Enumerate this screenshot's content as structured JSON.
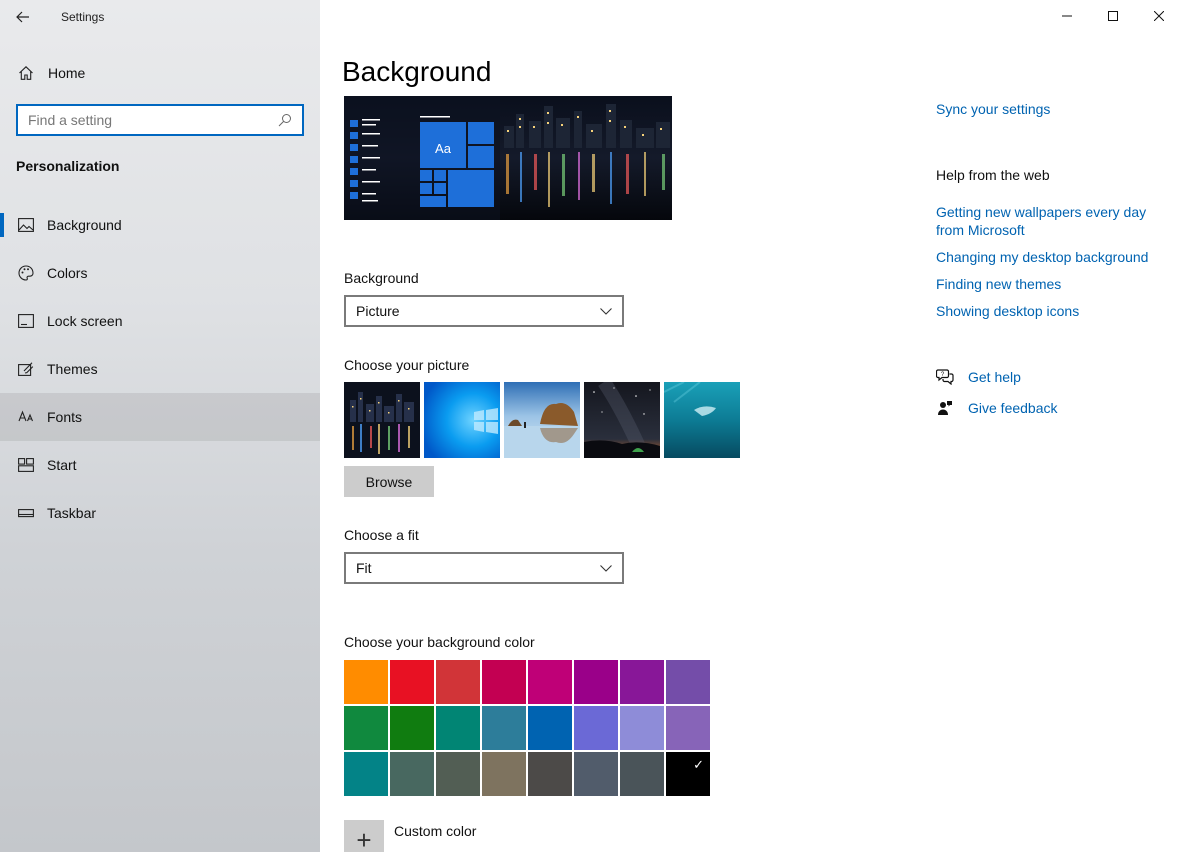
{
  "window": {
    "title": "Settings",
    "controls": [
      "minimize-icon",
      "maximize-icon",
      "close-icon"
    ]
  },
  "sidebar": {
    "home_label": "Home",
    "search_placeholder": "Find a setting",
    "section": "Personalization",
    "items": [
      {
        "label": "Background",
        "icon": "picture-icon",
        "selected": true
      },
      {
        "label": "Colors",
        "icon": "palette-icon"
      },
      {
        "label": "Lock screen",
        "icon": "lock-screen-icon"
      },
      {
        "label": "Themes",
        "icon": "themes-icon"
      },
      {
        "label": "Fonts",
        "icon": "fonts-icon",
        "hover": true
      },
      {
        "label": "Start",
        "icon": "start-icon"
      },
      {
        "label": "Taskbar",
        "icon": "taskbar-icon"
      }
    ]
  },
  "main": {
    "title": "Background",
    "preview_tile_text": "Aa",
    "background_label": "Background",
    "background_value": "Picture",
    "choose_picture_label": "Choose your picture",
    "browse_label": "Browse",
    "fit_label": "Choose a fit",
    "fit_value": "Fit",
    "color_label": "Choose your background color",
    "colors": [
      "#ff8c00",
      "#e81123",
      "#d13438",
      "#c30052",
      "#bf0077",
      "#9a0089",
      "#881798",
      "#744da9",
      "#10893e",
      "#107c10",
      "#018574",
      "#2d7d9a",
      "#0063b1",
      "#6b69d6",
      "#8e8cd8",
      "#8764b8",
      "#038387",
      "#486860",
      "#525e54",
      "#7e735f",
      "#4c4a48",
      "#515c6b",
      "#4a5459",
      "#000000"
    ],
    "selected_color_index": 23,
    "custom_color_label": "Custom color"
  },
  "right": {
    "sync_link": "Sync your settings",
    "help_title": "Help from the web",
    "help_links": [
      "Getting new wallpapers every day from Microsoft",
      "Changing my desktop background",
      "Finding new themes",
      "Showing desktop icons"
    ],
    "get_help": "Get help",
    "give_feedback": "Give feedback"
  },
  "accent_color": "#0067c0"
}
